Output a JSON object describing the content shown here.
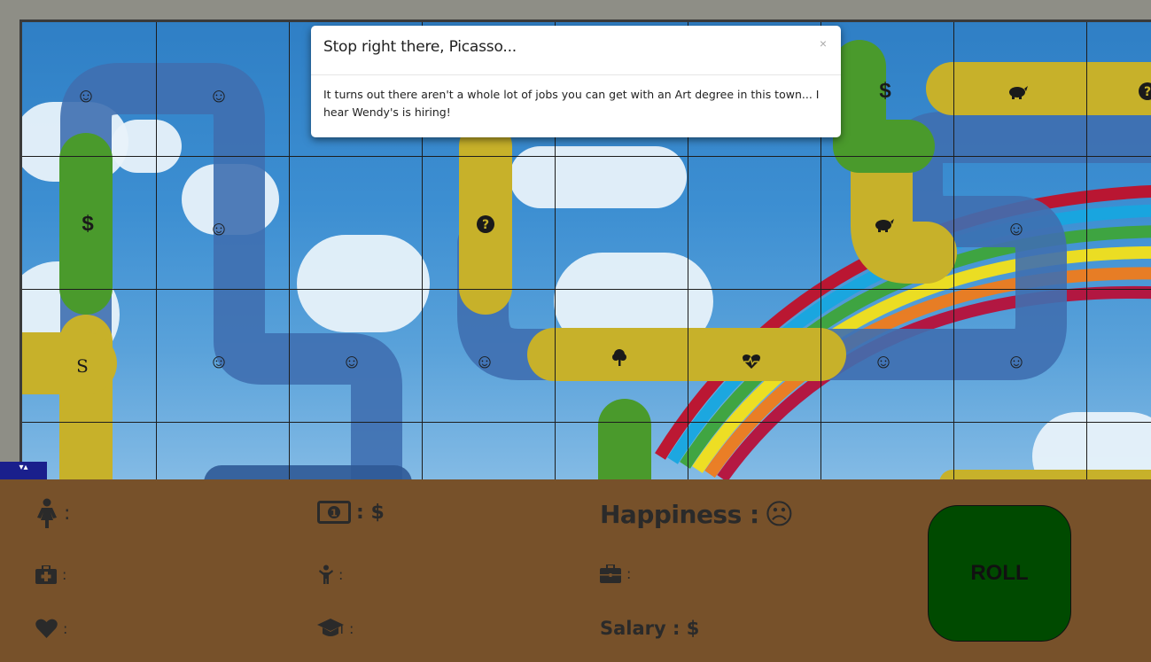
{
  "modal": {
    "title": "Stop right there, Picasso...",
    "close": "×",
    "message": "It turns out there aren't a whole lot of jobs you can get with an Art degree in this town... I hear Wendy's is hiring!"
  },
  "board": {
    "icons": {
      "smiley": "☺",
      "dollar": "$",
      "start": "S",
      "question": "?",
      "piggy": "piggy-bank-icon",
      "tree": "tree-icon",
      "health": "heartbeat-icon"
    }
  },
  "toggle_label": "▾▴",
  "stats": {
    "gender_label": ":",
    "money_label": ": $",
    "happiness_label": "Happiness :",
    "happiness_face": "☹",
    "insurance_label": ":",
    "children_label": ":",
    "job_label": ":",
    "health_label": ":",
    "education_label": ":",
    "salary_label": "Salary : $"
  },
  "roll_label": "ROLL",
  "colors": {
    "panel": "#77512a",
    "roll_button": "#004a00",
    "path_blue": "#3f6fb0",
    "path_yellow": "#c7b12a",
    "path_green": "#4a9a2c"
  }
}
